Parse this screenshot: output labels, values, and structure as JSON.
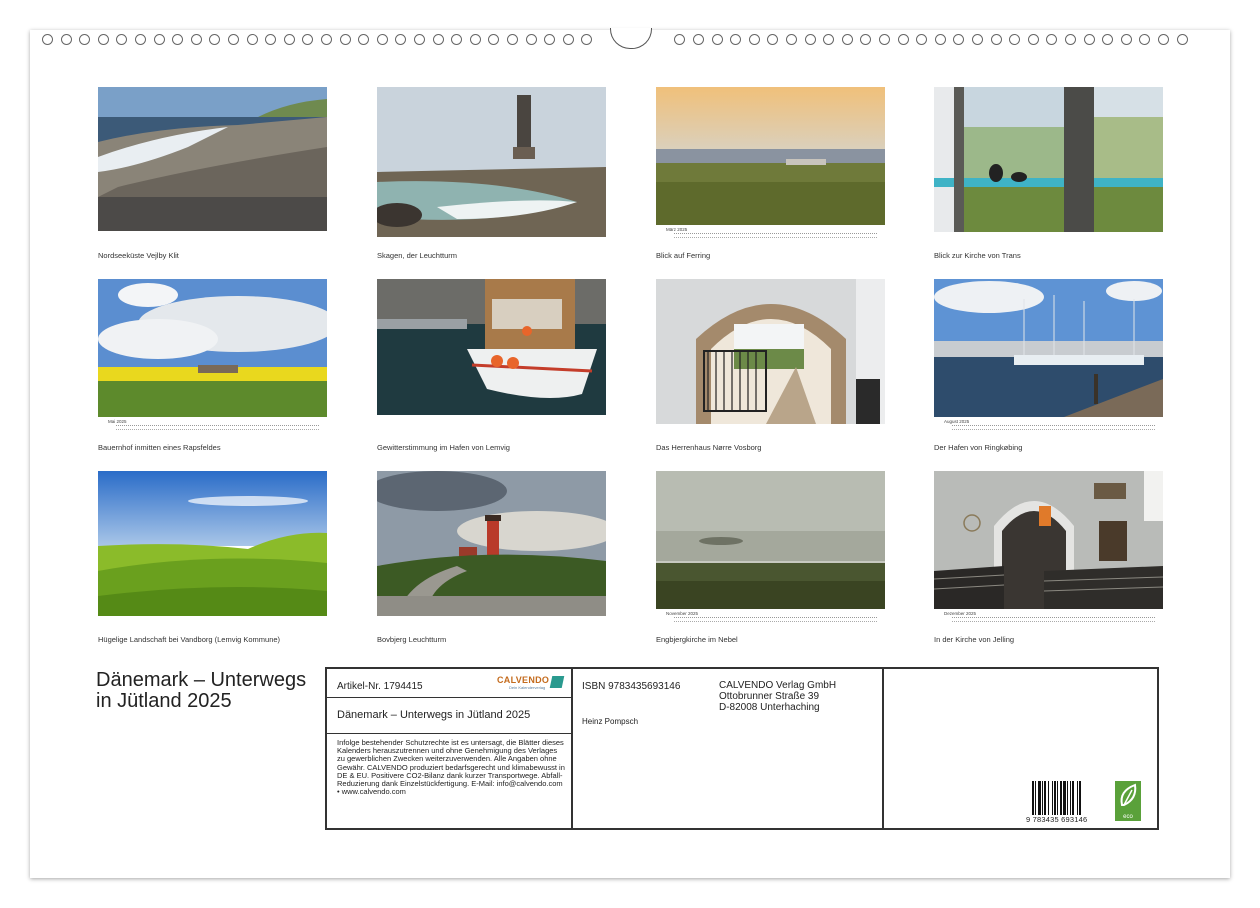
{
  "photos": [
    {
      "caption": "Nordseeküste Vejlby Klit",
      "month": ""
    },
    {
      "caption": "Skagen, der Leuchtturm",
      "month": ""
    },
    {
      "caption": "Blick auf Ferring",
      "month": "März 2025"
    },
    {
      "caption": "Blick zur Kirche von Trans",
      "month": ""
    },
    {
      "caption": "Bauernhof inmitten eines Rapsfeldes",
      "month": "Mai 2025"
    },
    {
      "caption": "Gewitterstimmung im Hafen von Lemvig",
      "month": ""
    },
    {
      "caption": "Das Herrenhaus Nørre Vosborg",
      "month": ""
    },
    {
      "caption": "Der Hafen von Ringkøbing",
      "month": "August 2025"
    },
    {
      "caption": "Hügelige Landschaft bei Vandborg (Lemvig Kommune)",
      "month": ""
    },
    {
      "caption": "Bovbjerg Leuchtturm",
      "month": ""
    },
    {
      "caption": "Engbjergkirche im Nebel",
      "month": "November 2025"
    },
    {
      "caption": "In der Kirche von Jelling",
      "month": "Dezember 2025"
    }
  ],
  "title_line1": "Dänemark – Unterwegs",
  "title_line2": "in Jütland 2025",
  "info": {
    "article": "Artikel-Nr. 1794415",
    "logo_word": "CALVENDO",
    "logo_sub": "Dein Kalenderverlag",
    "book_title": "Dänemark – Unterwegs in Jütland 2025",
    "legal": "Infolge bestehender Schutzrechte ist es untersagt, die Blätter dieses Kalenders herauszutrennen und ohne Genehmigung des Verlages zu gewerblichen Zwecken weiterzuverwenden. Alle Angaben ohne Gewähr. CALVENDO produziert bedarfsgerecht und klimabewusst in DE & EU. Positivere CO2-Bilanz dank kurzer Transportwege. Abfall-Reduzierung dank Einzelstückfertigung. E-Mail: info@calvendo.com • www.calvendo.com",
    "isbn": "ISBN 9783435693146",
    "author": "Heinz Pompsch",
    "publisher_l1": "CALVENDO Verlag GmbH",
    "publisher_l2": "Ottobrunner Straße 39",
    "publisher_l3": "D-82008 Unterhaching",
    "barcode_number": "9 783435 693146",
    "eco_label": "eco"
  }
}
